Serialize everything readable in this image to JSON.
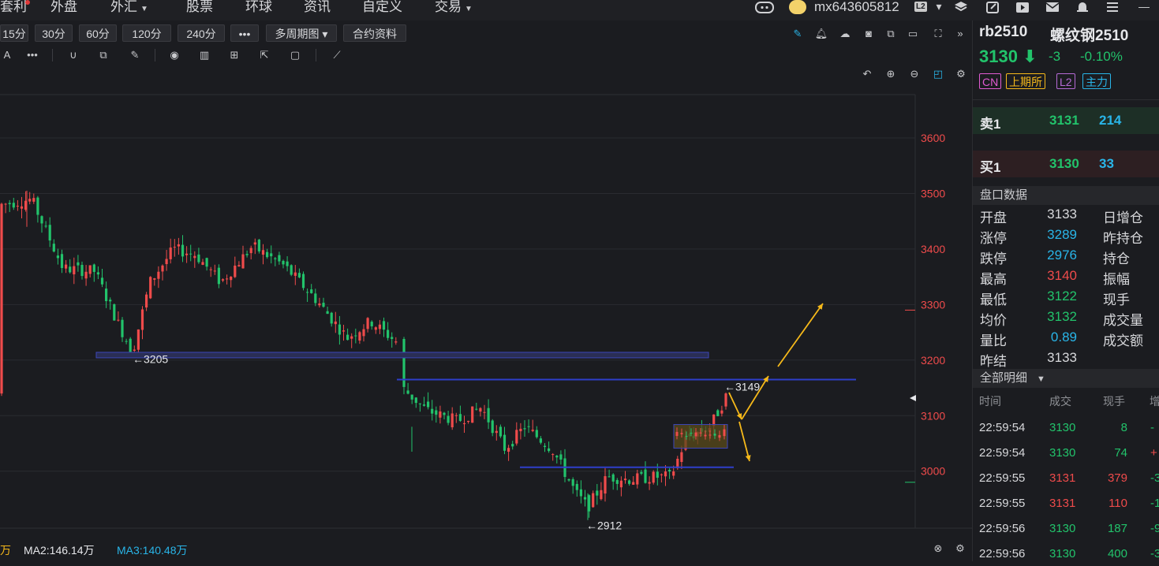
{
  "nav": {
    "items": [
      {
        "label": "套利",
        "x": 0,
        "caret": false
      },
      {
        "label": "外盘",
        "x": 64,
        "caret": false
      },
      {
        "label": "外汇",
        "x": 140,
        "caret": true
      },
      {
        "label": "股票",
        "x": 236,
        "caret": false
      },
      {
        "label": "环球",
        "x": 311,
        "caret": false
      },
      {
        "label": "资讯",
        "x": 385,
        "caret": false
      },
      {
        "label": "自定义",
        "x": 459,
        "caret": false
      },
      {
        "label": "交易",
        "x": 551,
        "caret": true
      }
    ],
    "username": "mx643605812",
    "user_badge": "L2"
  },
  "periods": [
    "15分",
    "30分",
    "60分",
    "120分",
    "240分",
    "•••",
    "多周期图",
    "合约资料"
  ],
  "symbol": {
    "code": "rb2510",
    "name": "螺纹钢2510",
    "last": "3130",
    "change": "-3",
    "change_pct": "-0.10%",
    "tags": [
      "CN",
      "上期所",
      "L2",
      "主力"
    ]
  },
  "orderbook": {
    "ask": {
      "label": "卖1",
      "price": "3131",
      "vol": "214"
    },
    "bid": {
      "label": "买1",
      "price": "3130",
      "vol": "33"
    }
  },
  "panel_title": "盘口数据",
  "stats_left": [
    {
      "label": "开盘",
      "value": "3133",
      "color": "#d7d8db"
    },
    {
      "label": "涨停",
      "value": "3289",
      "color": "#29b5e8"
    },
    {
      "label": "跌停",
      "value": "2976",
      "color": "#29b5e8"
    },
    {
      "label": "最高",
      "value": "3140",
      "color": "#ef4b4b"
    },
    {
      "label": "最低",
      "value": "3122",
      "color": "#22c36b"
    },
    {
      "label": "均价",
      "value": "3132",
      "color": "#22c36b"
    },
    {
      "label": "量比",
      "value": "0.89",
      "color": "#29b5e8"
    },
    {
      "label": "昨结",
      "value": "3133",
      "color": "#d7d8db"
    }
  ],
  "stats_right": [
    "日增仓",
    "昨持仓",
    "持仓",
    "振幅",
    "现手",
    "成交量",
    "成交额"
  ],
  "trades_title": "全部明细",
  "trades_head": [
    "时间",
    "成交",
    "现手",
    "增"
  ],
  "trades": [
    {
      "time": "22:59:54",
      "price": "3130",
      "vol": "8",
      "pc": "#22c36b",
      "vc": "#22c36b",
      "delta": "-"
    },
    {
      "time": "22:59:54",
      "price": "3130",
      "vol": "74",
      "pc": "#22c36b",
      "vc": "#22c36b",
      "delta": "+"
    },
    {
      "time": "22:59:55",
      "price": "3131",
      "vol": "379",
      "pc": "#ef4b4b",
      "vc": "#ef4b4b",
      "delta": "-3"
    },
    {
      "time": "22:59:55",
      "price": "3131",
      "vol": "110",
      "pc": "#ef4b4b",
      "vc": "#ef4b4b",
      "delta": "-1"
    },
    {
      "time": "22:59:56",
      "price": "3130",
      "vol": "187",
      "pc": "#22c36b",
      "vc": "#22c36b",
      "delta": "-9"
    },
    {
      "time": "22:59:56",
      "price": "3130",
      "vol": "400",
      "pc": "#22c36b",
      "vc": "#22c36b",
      "delta": "-3"
    }
  ],
  "chart": {
    "y_ticks": [
      3600,
      3500,
      3400,
      3300,
      3200,
      3100,
      3000
    ],
    "annotations": [
      "←3205",
      "←3149",
      "←2912"
    ],
    "price_marker_up": "3290",
    "price_marker_down": "2980"
  },
  "ma": {
    "ma1": "万",
    "ma2": "MA2:146.14万",
    "ma3": "MA3:140.48万"
  },
  "colors": {
    "up": "#ef4b4b",
    "down": "#22c36b",
    "accent": "#29b5e8",
    "line": "#2e3ec9",
    "arrow": "#f6b91a"
  }
}
